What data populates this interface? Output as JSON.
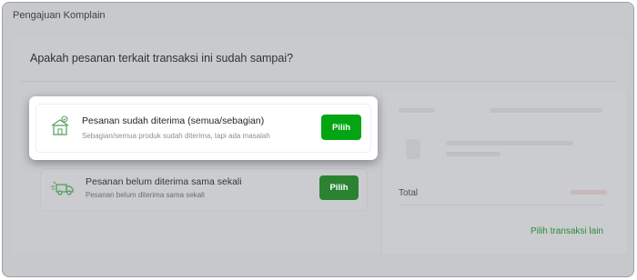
{
  "header": {
    "title": "Pengajuan Komplain"
  },
  "question": "Apakah pesanan terkait transaksi ini sudah sampai?",
  "options": [
    {
      "title": "Pesanan sudah diterima (semua/sebagian)",
      "subtitle": "Sebagian/semua produk sudah diterima, tapi ada masalah",
      "button_label": "Pilih",
      "icon": "house-package-icon",
      "selected": true
    },
    {
      "title": "Pesanan belum diterima sama sekali",
      "subtitle": "Pesanan belum diterima sama sekali",
      "button_label": "Pilih",
      "icon": "delivery-truck-icon",
      "selected": false
    }
  ],
  "transaction_panel": {
    "total_label": "Total",
    "link_label": "Pilih transaksi lain"
  },
  "colors": {
    "accent_green": "#03a513",
    "dim_green": "#2b8332",
    "overlay": "#c7c8cc",
    "link_green": "#2f8a3a"
  }
}
